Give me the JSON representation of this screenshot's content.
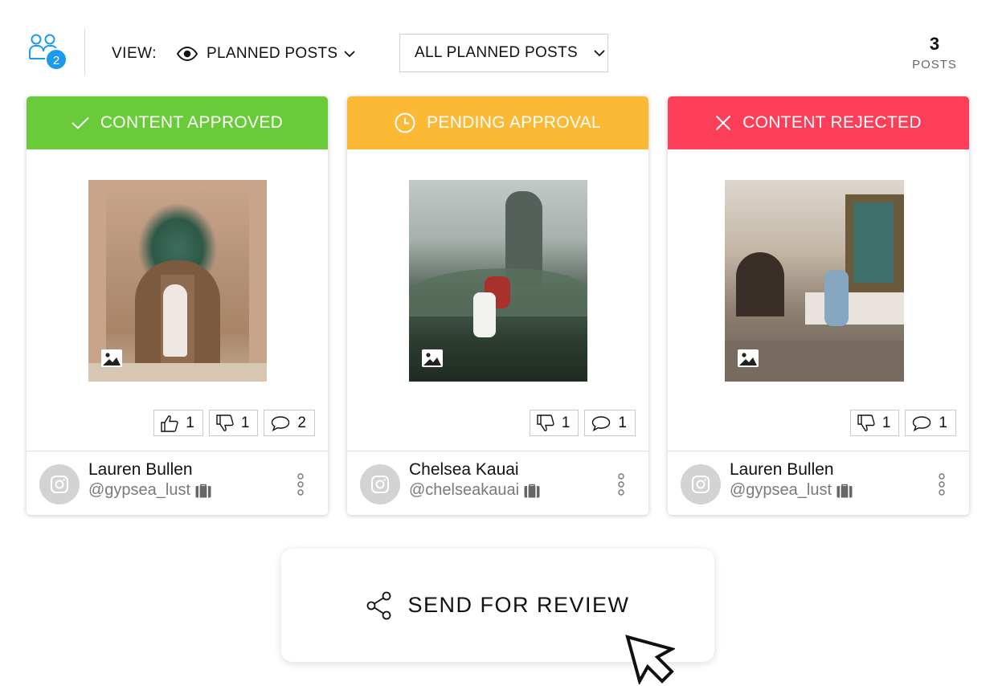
{
  "toolbar": {
    "team_badge_count": "2",
    "view_label": "VIEW:",
    "view_value": "PLANNED POSTS",
    "filter_value": "ALL PLANNED POSTS",
    "posts_count": "3",
    "posts_label": "POSTS"
  },
  "colors": {
    "approved": "#6acb3a",
    "pending": "#fbb935",
    "rejected": "#fd3e59",
    "accent": "#1a9bf0"
  },
  "cards": [
    {
      "status": "CONTENT APPROVED",
      "status_icon": "check-icon",
      "stats": {
        "likes": "1",
        "dislikes": "1",
        "comments": "2"
      },
      "account_name": "Lauren Bullen",
      "account_handle": "@gypsea_lust"
    },
    {
      "status": "PENDING APPROVAL",
      "status_icon": "clock-icon",
      "stats": {
        "dislikes": "1",
        "comments": "1"
      },
      "account_name": "Chelsea Kauai",
      "account_handle": "@chelseakauai"
    },
    {
      "status": "CONTENT REJECTED",
      "status_icon": "x-icon",
      "stats": {
        "dislikes": "1",
        "comments": "1"
      },
      "account_name": "Lauren Bullen",
      "account_handle": "@gypsea_lust"
    }
  ],
  "send_button": {
    "label": "SEND FOR REVIEW",
    "icon": "share-icon"
  }
}
